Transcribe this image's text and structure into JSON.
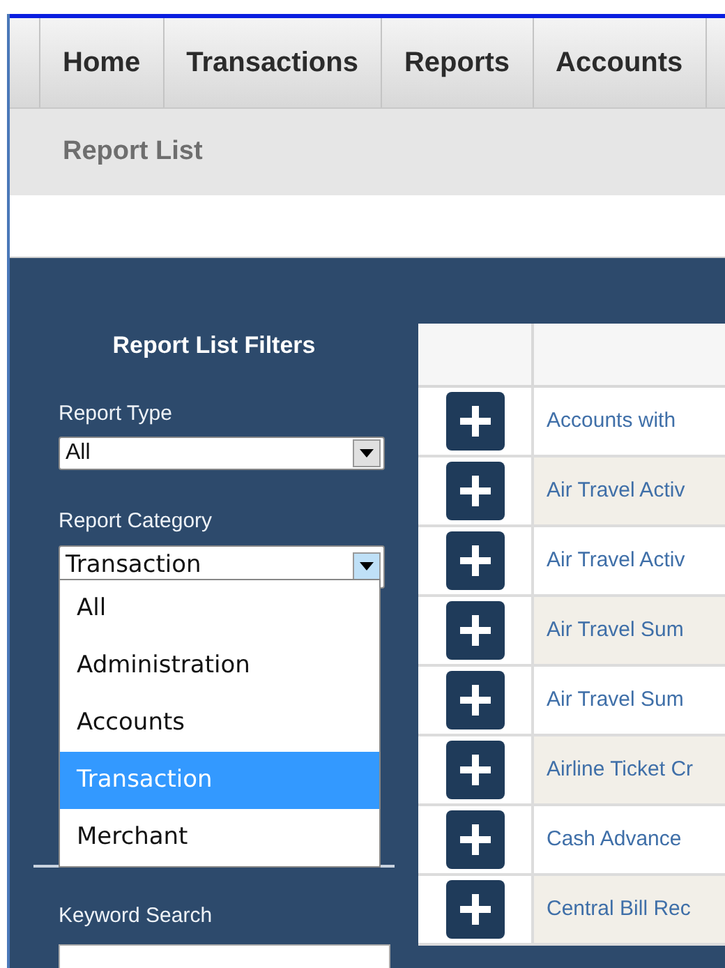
{
  "nav_tabs": [
    {
      "label": "Home",
      "selected": false
    },
    {
      "label": "Transactions",
      "selected": false
    },
    {
      "label": "Reports",
      "selected": false
    },
    {
      "label": "Accounts",
      "selected": false
    }
  ],
  "breadcrumb": "Report List",
  "filters": {
    "title": "Report List Filters",
    "report_type": {
      "label": "Report Type",
      "value": "All"
    },
    "report_category": {
      "label": "Report Category",
      "value": "Transaction",
      "expanded": true,
      "options": [
        {
          "label": "All",
          "selected": false
        },
        {
          "label": "Administration",
          "selected": false
        },
        {
          "label": "Accounts",
          "selected": false
        },
        {
          "label": "Transaction",
          "selected": true
        },
        {
          "label": "Merchant",
          "selected": false
        }
      ]
    },
    "keyword_search": {
      "label": "Keyword Search"
    }
  },
  "reports": [
    {
      "name": "Accounts with"
    },
    {
      "name": "Air Travel Activ"
    },
    {
      "name": "Air Travel Activ"
    },
    {
      "name": "Air Travel Sum"
    },
    {
      "name": "Air Travel Sum"
    },
    {
      "name": "Airline Ticket Cr"
    },
    {
      "name": "Cash Advance"
    },
    {
      "name": "Central Bill Rec"
    }
  ]
}
